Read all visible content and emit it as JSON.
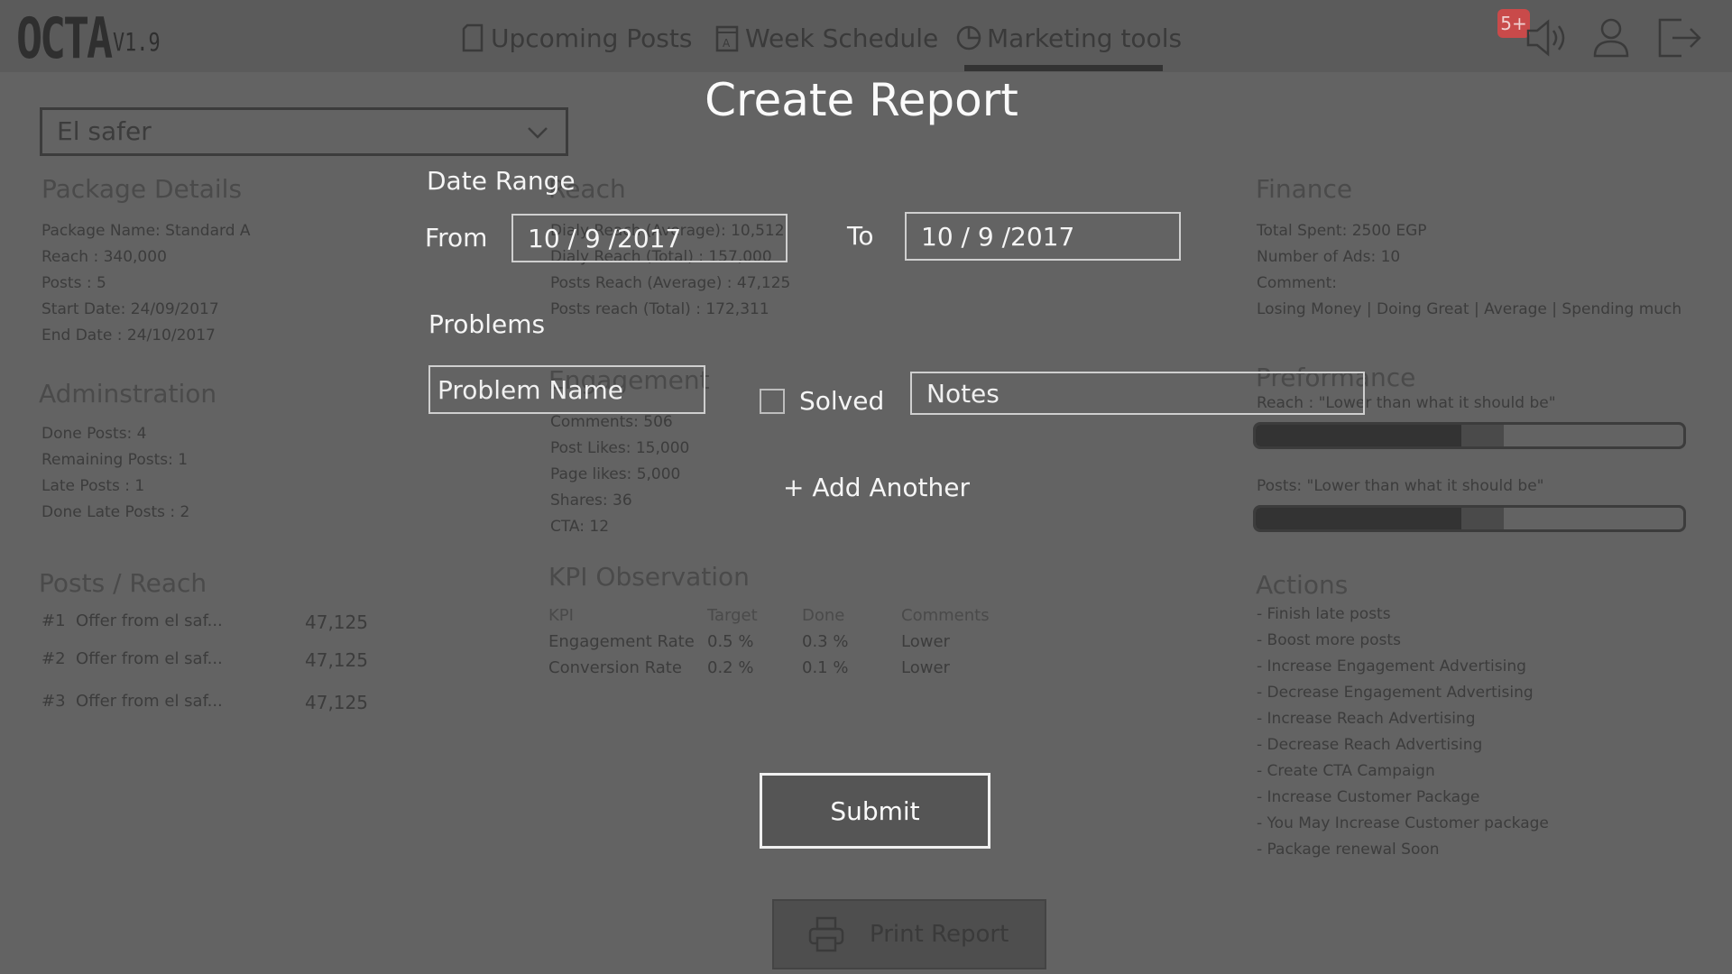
{
  "app": {
    "logo": "OCTA",
    "version": "V1.9"
  },
  "nav": {
    "items": [
      {
        "label": "Upcoming Posts",
        "icon": "document-icon"
      },
      {
        "label": "Week Schedule",
        "icon": "calendar-icon"
      },
      {
        "label": "Marketing tools",
        "icon": "pie-chart-icon"
      }
    ],
    "active": "Marketing tools",
    "notification_badge": "5+"
  },
  "client_select": {
    "value": "El safer"
  },
  "package": {
    "title": "Package Details",
    "lines": [
      "Package Name: Standard A",
      "Reach : 340,000",
      "Posts  : 5",
      "Start Date: 24/09/2017",
      "End Date   : 24/10/2017"
    ]
  },
  "administration": {
    "title": "Adminstration",
    "lines": [
      "Done Posts: 4",
      "Remaining Posts: 1",
      "Late Posts : 1",
      "Done Late Posts : 2"
    ]
  },
  "posts_reach": {
    "title": "Posts / Reach",
    "rows": [
      {
        "rank": "#1",
        "name": "Offer from el saf...",
        "value": "47,125"
      },
      {
        "rank": "#2",
        "name": "Offer from el saf...",
        "value": "47,125"
      },
      {
        "rank": "#3",
        "name": "Offer from el saf...",
        "value": "47,125"
      }
    ]
  },
  "reach": {
    "title": "Reach",
    "lines": [
      "Dialy Reach (Average): 10,512",
      "Dialy Reach (Total) : 157,000",
      "Posts Reach (Average) : 47,125",
      "Posts reach (Total) : 172,311"
    ]
  },
  "engagement": {
    "title": "Engagement",
    "lines": [
      "Comments: 506",
      "Post Likes: 15,000",
      "Page likes: 5,000",
      "Shares: 36",
      "CTA: 12"
    ]
  },
  "kpi": {
    "title": "KPI Observation",
    "headers": [
      "KPI",
      "Target",
      "Done",
      "Comments"
    ],
    "rows": [
      [
        "Engagement Rate",
        "0.5 %",
        "0.3 %",
        "Lower"
      ],
      [
        "Conversion Rate",
        "0.2 %",
        "0.1 %",
        "Lower"
      ]
    ]
  },
  "finance": {
    "title": "Finance",
    "lines": [
      "Total Spent: 2500 EGP",
      "Number of Ads: 10",
      "Comment:",
      "Losing Money | Doing Great | Average | Spending much"
    ]
  },
  "performance": {
    "title": "Preformance",
    "reach_label": "Reach : \"Lower than what it should be\"",
    "posts_label": "Posts: \"Lower than what it should be\"",
    "reach_level": 0.48,
    "posts_level": 0.48
  },
  "actions": {
    "title": "Actions",
    "items": [
      "- Finish late posts",
      "- Boost more posts",
      "- Increase Engagement Advertising",
      "- Decrease Engagement Advertising",
      "- Increase Reach Advertising",
      "- Decrease Reach Advertising",
      "- Create CTA Campaign",
      "- Increase Customer Package",
      "- You May Increase Customer package",
      "- Package renewal Soon"
    ]
  },
  "print_button": {
    "label": "Print Report"
  },
  "modal": {
    "title": "Create Report",
    "date_range_label": "Date Range",
    "from_label": "From",
    "from_value": "10 / 9 /2017",
    "to_label": "To",
    "to_value": "10 / 9 /2017",
    "problems_label": "Problems",
    "problem_placeholder": "Problem Name",
    "solved_label": "Solved",
    "notes_placeholder": "Notes",
    "add_another": "+ Add Another",
    "submit": "Submit"
  }
}
